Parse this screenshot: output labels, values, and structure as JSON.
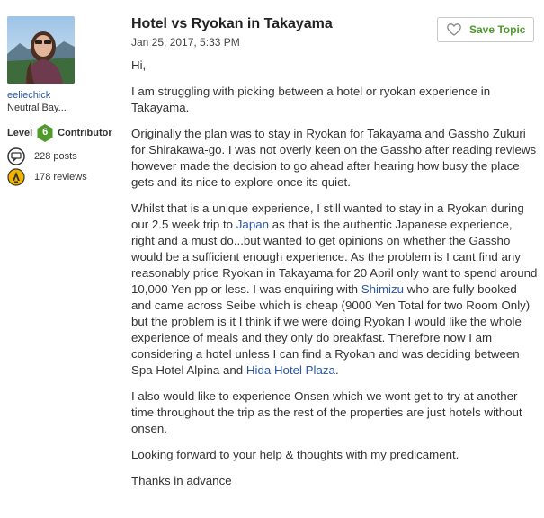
{
  "author": {
    "username": "eeliechick",
    "location": "Neutral Bay...",
    "level_label": "Level",
    "level_number": "6",
    "contributor_label": "Contributor",
    "posts": "228 posts",
    "reviews": "178 reviews"
  },
  "post": {
    "title": "Hotel vs Ryokan in Takayama",
    "date": "Jan 25, 2017, 5:33 PM",
    "save_label": "Save Topic",
    "greeting": "Hi,",
    "p1": "I am struggling with picking between a hotel or ryokan experience in Takayama.",
    "p2": "Originally the plan was to stay in Ryokan for Takayama and Gassho Zukuri for Shirakawa-go. I was not overly keen on the Gassho after reading reviews however made the decision to go ahead after hearing how busy the place gets and its nice to explore once its quiet.",
    "p3_a": "Whilst that is a unique experience, I still wanted to stay in a Ryokan during our 2.5 week trip to ",
    "p3_link_japan": "Japan",
    "p3_b": " as that is the authentic Japanese experience, right and a must do...but wanted to get opinions on whether the Gassho would be a sufficient enough experience. As the problem is I cant find any reasonably price Ryokan in Takayama for 20 April only want to spend around 10,000 Yen pp or less. I was enquiring with ",
    "p3_link_shimizu": "Shimizu",
    "p3_c": " who are fully booked and came across Seibe which is cheap (9000 Yen Total for two Room Only) but the problem is it I think if we were doing Ryokan I would like the whole experience of meals and they only do breakfast. Therefore now I am considering a hotel unless I can find a Ryokan and was deciding between Spa Hotel Alpina and ",
    "p3_link_hida": "Hida Hotel Plaza",
    "p3_d": ".",
    "p4": "I also would like to experience Onsen which we wont get to try at another time throughout the trip as the rest of the properties are just hotels without onsen.",
    "p5": "Looking forward to your help & thoughts with my predicament.",
    "p6": "Thanks in advance"
  },
  "colors": {
    "link": "#2a56a6",
    "save_green": "#4f9a2b",
    "level_badge": "#4f9a2b"
  },
  "icons": {
    "posts": "speech-bubble-icon",
    "reviews": "pencil-badge-icon",
    "save": "heart-icon"
  }
}
